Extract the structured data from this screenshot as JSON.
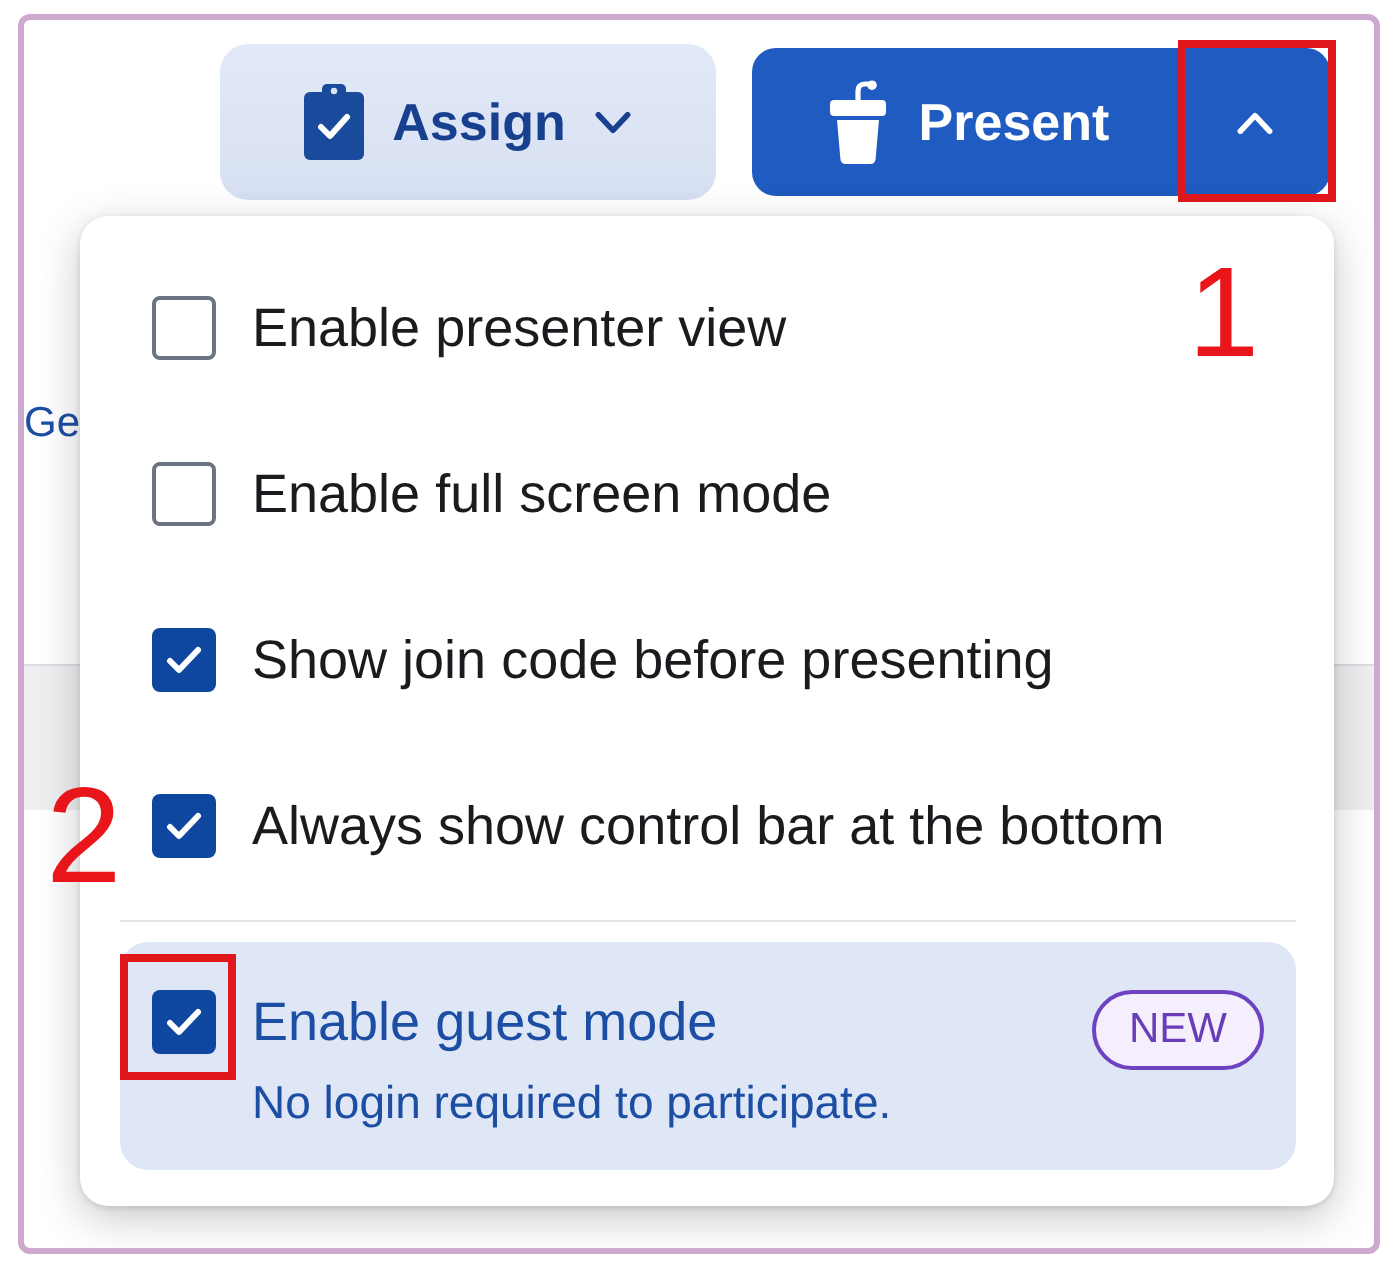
{
  "toolbar": {
    "assign": {
      "label": "Assign",
      "expanded": false
    },
    "present": {
      "label": "Present"
    },
    "present_menu_toggle": {
      "expanded": true,
      "highlighted": true,
      "callout": "1"
    }
  },
  "background": {
    "link_text": "Ge"
  },
  "present_menu": {
    "options": [
      {
        "kind": "plain",
        "label": "Enable presenter view",
        "checked": false,
        "highlighted": false
      },
      {
        "kind": "plain",
        "label": "Enable full screen mode",
        "checked": false,
        "highlighted": false
      },
      {
        "kind": "plain",
        "label": "Show join code before presenting",
        "checked": true,
        "highlighted": false
      },
      {
        "kind": "plain",
        "label": "Always show control bar at the bottom",
        "checked": true,
        "highlighted": false
      },
      {
        "kind": "featured",
        "label": "Enable guest mode",
        "description": "No login required to participate.",
        "badge": "NEW",
        "checked": true,
        "highlighted": true,
        "callout": "2"
      }
    ]
  }
}
